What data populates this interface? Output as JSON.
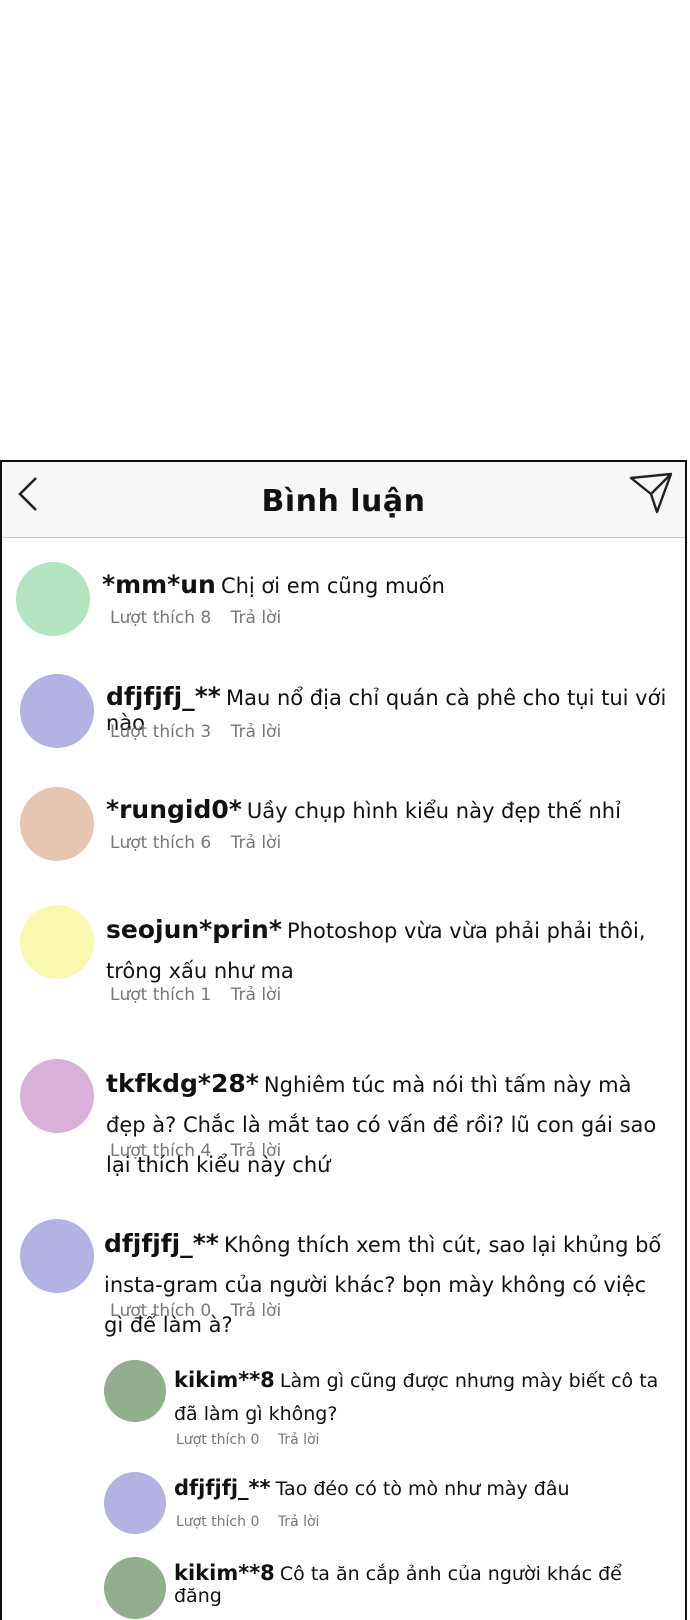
{
  "header": {
    "title": "Bình luận"
  },
  "colors": {
    "green": "#b3e3bf",
    "purple": "#b4b1e3",
    "peach": "#e6c5b1",
    "yellow": "#f8f8b0",
    "pink": "#d9b0d9",
    "sage": "#93ad8f"
  },
  "comments": [
    {
      "user": "*mm*un",
      "text": "Chị ơi em cũng muốn",
      "likes": "Lượt thích 8",
      "reply": "Trả lời"
    },
    {
      "user": "dfjfjfj_**",
      "text": "Mau nổ địa chỉ quán cà phê cho tụi tui với nào",
      "likes": "Lượt thích 3",
      "reply": "Trả lời"
    },
    {
      "user": "*rungid0*",
      "text": "Uầy chụp hình kiểu này đẹp thế nhỉ",
      "likes": "Lượt thích 6",
      "reply": "Trả lời"
    },
    {
      "user": "seojun*prin*",
      "text": "Photoshop vừa vừa phải phải thôi, trông xấu như ma",
      "likes": "Lượt thích 1",
      "reply": "Trả lời"
    },
    {
      "user": "tkfkdg*28*",
      "text": "Nghiêm túc mà nói thì tấm này mà đẹp à? Chắc là mắt tao có vấn đề rồi? lũ con gái sao lại thích kiểu này chứ",
      "likes": "Lượt thích 4",
      "reply": "Trả lời"
    },
    {
      "user": "dfjfjfj_**",
      "text": "Không thích xem thì cút, sao lại khủng bố insta-gram của người khác? bọn mày không có việc gì để làm à?",
      "likes": "Lượt thích 0",
      "reply": "Trả lời"
    }
  ],
  "replies": [
    {
      "user": "kikim**8",
      "text": "Làm gì cũng được nhưng mày biết cô ta đã làm gì không?",
      "likes": "Lượt thích 0",
      "reply": "Trả lời"
    },
    {
      "user": "dfjfjfj_**",
      "text": "Tao đéo có tò mò như mày đâu",
      "likes": "Lượt thích 0",
      "reply": "Trả lời"
    },
    {
      "user": "kikim**8",
      "text": "Cô ta ăn cắp ảnh của người khác để đăng",
      "likes": "",
      "reply": ""
    }
  ]
}
